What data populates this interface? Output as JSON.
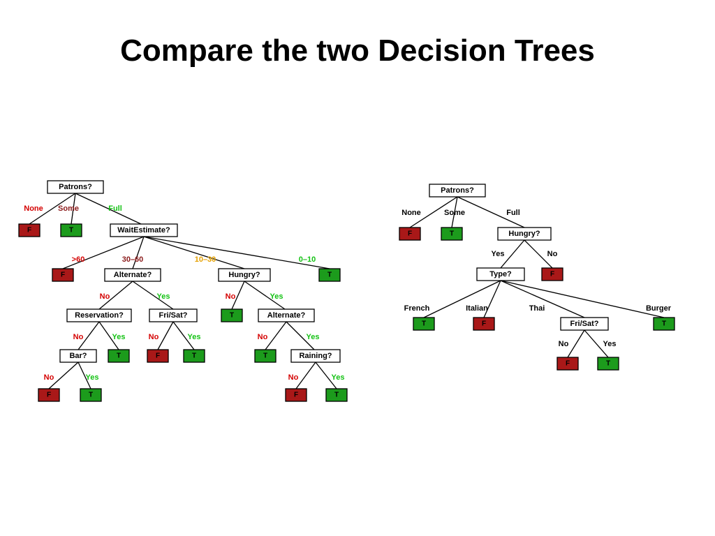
{
  "title": "Compare the two Decision Trees",
  "leaf_true": "T",
  "leaf_false": "F",
  "tree_left": {
    "root": "Patrons?",
    "root_edges": {
      "none": "None",
      "some": "Some",
      "full": "Full"
    },
    "wait": "WaitEstimate?",
    "wait_edges": {
      "gt60": ">60",
      "30_60": "30–60",
      "10_30": "10–30",
      "0_10": "0–10"
    },
    "alt1": "Alternate?",
    "hungry": "Hungry?",
    "yes": "Yes",
    "no": "No",
    "reservation": "Reservation?",
    "frisat": "Fri/Sat?",
    "alt2": "Alternate?",
    "bar": "Bar?",
    "raining": "Raining?"
  },
  "tree_right": {
    "root": "Patrons?",
    "root_edges": {
      "none": "None",
      "some": "Some",
      "full": "Full"
    },
    "hungry": "Hungry?",
    "yes": "Yes",
    "no": "No",
    "type": "Type?",
    "type_edges": {
      "french": "French",
      "italian": "Italian",
      "thai": "Thai",
      "burger": "Burger"
    },
    "frisat": "Fri/Sat?"
  }
}
